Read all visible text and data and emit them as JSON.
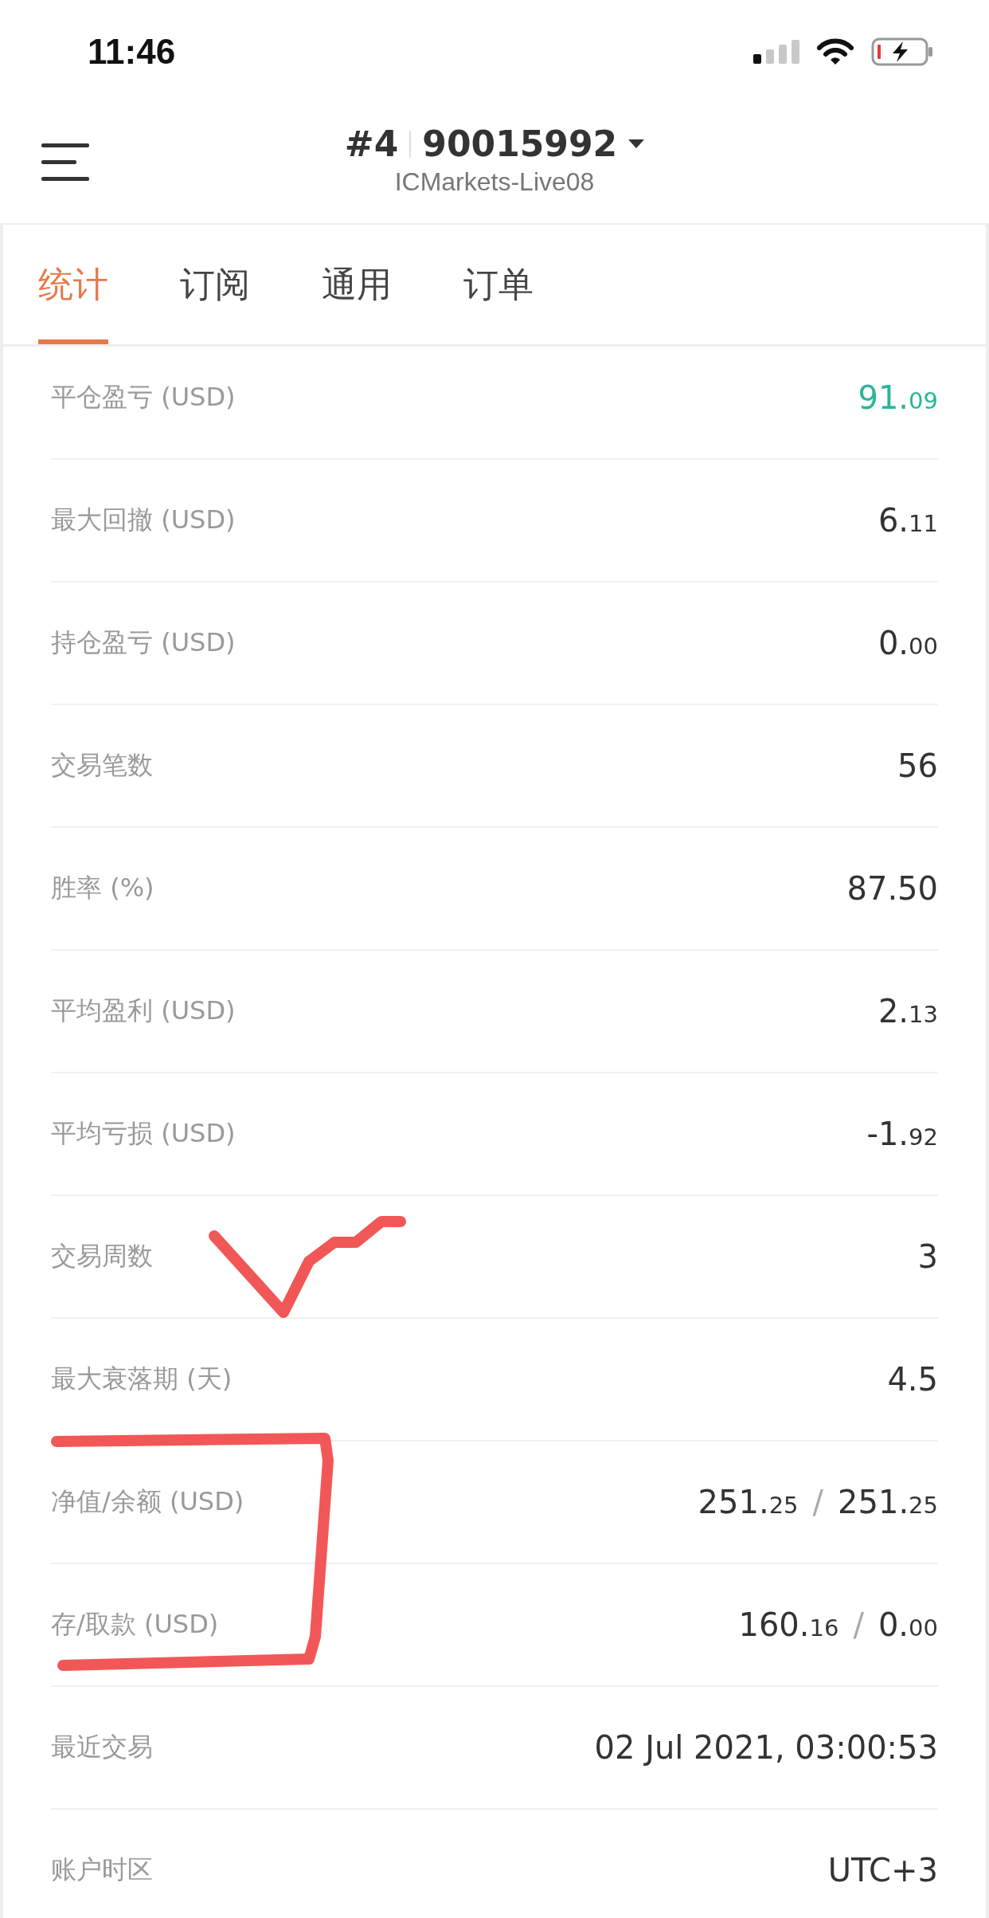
{
  "status_bar": {
    "time": "11:46"
  },
  "header": {
    "account_number": "#4",
    "account_id": "90015992",
    "server": "ICMarkets-Live08"
  },
  "tabs": [
    {
      "label": "统计",
      "selected": true
    },
    {
      "label": "订阅",
      "selected": false
    },
    {
      "label": "通用",
      "selected": false
    },
    {
      "label": "订单",
      "selected": false
    }
  ],
  "rows": [
    {
      "label": "平仓盈亏 (USD)",
      "positive": true,
      "values": [
        {
          "whole": "91.",
          "fraction": "09"
        }
      ]
    },
    {
      "label": "最大回撤 (USD)",
      "positive": false,
      "values": [
        {
          "whole": "6.",
          "fraction": "11"
        }
      ]
    },
    {
      "label": "持仓盈亏 (USD)",
      "positive": false,
      "values": [
        {
          "whole": "0.",
          "fraction": "00"
        }
      ]
    },
    {
      "label": "交易笔数",
      "positive": false,
      "values": [
        {
          "whole": "56"
        }
      ]
    },
    {
      "label": "胜率 (%)",
      "positive": false,
      "values": [
        {
          "whole": "87.50"
        }
      ]
    },
    {
      "label": "平均盈利 (USD)",
      "positive": false,
      "values": [
        {
          "whole": "2.",
          "fraction": "13"
        }
      ]
    },
    {
      "label": "平均亏损 (USD)",
      "positive": false,
      "values": [
        {
          "whole": "-1.",
          "fraction": "92"
        }
      ]
    },
    {
      "label": "交易周数",
      "positive": false,
      "values": [
        {
          "whole": "3"
        }
      ]
    },
    {
      "label": "最大衰落期 (天)",
      "positive": false,
      "values": [
        {
          "whole": "4.5"
        }
      ]
    },
    {
      "label": "净值/余额 (USD)",
      "positive": false,
      "separator": "/",
      "values": [
        {
          "whole": "251.",
          "fraction": "25"
        },
        {
          "whole": "251.",
          "fraction": "25"
        }
      ]
    },
    {
      "label": "存/取款 (USD)",
      "positive": false,
      "separator": "/",
      "values": [
        {
          "whole": "160.",
          "fraction": "16"
        },
        {
          "whole": "0.",
          "fraction": "00"
        }
      ]
    },
    {
      "label": "最近交易",
      "positive": false,
      "values": [
        {
          "whole": "02 Jul 2021, 03:00:53"
        }
      ]
    },
    {
      "label": "账户时区",
      "positive": false,
      "values": [
        {
          "whole": "UTC+3"
        }
      ]
    }
  ]
}
